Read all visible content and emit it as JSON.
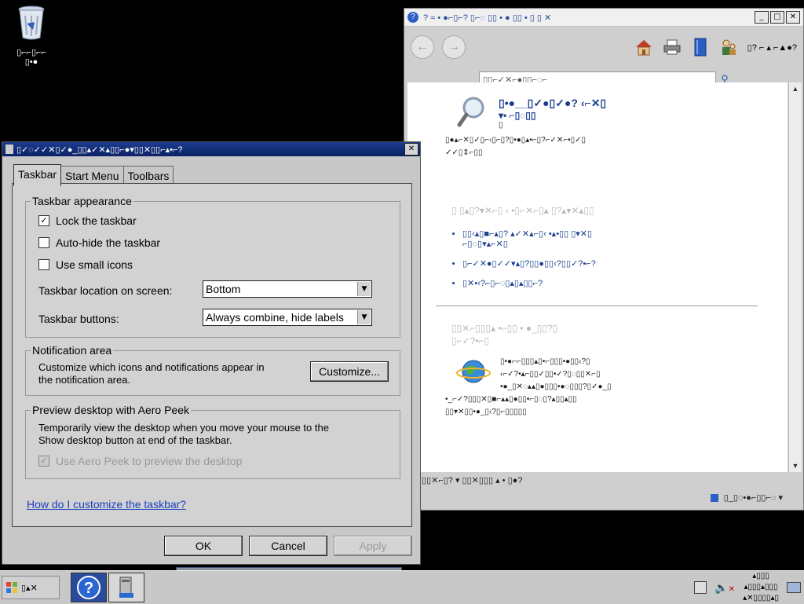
{
  "desktop": {
    "recycle_bin_label_line1": "▯⌐⌐▯⌐⌐",
    "recycle_bin_label_line2": "▯•●"
  },
  "help_window": {
    "title": "? ≈ • ●⌐▯⌐? ▯⌐◌ ▯▯ • ● ▯▯ • ▯ ▯ ✕",
    "toolbar_label": "▯? ⌐ ▴ ⌐▲●?",
    "search_text": "▯▯⌐✓✕⌐●▯▯⌐◌⌐",
    "heading": "▯•●__▯✓●▯✓●? ‹⌐✕▯",
    "heading2": "▾• ⌐▯◌▯▯",
    "heading_small": "▯",
    "intro": "▯●▴⌐✕▯✓▯⌐‹▯⌐▯?▯•●▯▴•⌐▯?⌐✓✕⌐•▯✓▯",
    "intro2": "✓✓▯⇕⌐▯▯",
    "subhead1": "▯ ▯▴▯?▾✕⌐▯ ‹ •▯⌐✕⌐▯▴ ▯?▴▾✕▴▯▯",
    "bullets": [
      "▯▯‹▴▯■⌐▴▯? ▴✓✕▴⌐▯‹ •▴•▯▯ ▯▾✕▯",
      "▯⌐✓✕●▯✓✓▾▴▯?▯▯●▯▯‹?▯▯✓?•⌐?",
      "▯✕•‹?⌐▯⌐◌▯▴▯▴▯▯⌐?"
    ],
    "bullet_cont": "⌐▯◌▯▾▴⌐✕▯",
    "subhead2": "▯▯✕⌐▯▯▯▴ •⌐▯▯ • ●_▯▯?▯",
    "subhead2b": "▯⌐✓?•⌐▯",
    "body_lines": [
      "▯•●⌐⌐▯▯▯▴▯•⌐▯▯▯•●▯▯‹?▯",
      "‹⌐✓?•▴⌐▯▯✓▯▯•✓?▯◌▯▯✕⌐▯",
      "•●_▯✕◌▴▴▯●▯▯▯•●◌▯▯▯?▯✓●_▯",
      "•_⌐✓?▯▯▯✕▯■⌐▴▴▯●▯▯•⌐▯◌▯?▴▯▯▴▯▯",
      "▯▯▾✕▯▯•●_▯‹?▯⌐▯▯▯▯▯"
    ],
    "status_left": "▯▯✕⌐▯? ▾ ▯▯✕▯▯▯ ▴ • ▯●?",
    "status_right": "▯_▯◌•●⌐▯▯⌐◌ ▾"
  },
  "dialog": {
    "title": "▯✓◌✓✓✕▯✓●_▯▯▴✓✕▴▯▯⌐●▾▯▯✕▯▯⌐▴•⌐?",
    "tabs": [
      "Taskbar",
      "Start Menu",
      "Toolbars"
    ],
    "appearance": {
      "legend": "Taskbar appearance",
      "lock_label": "Lock the taskbar",
      "lock_checked": true,
      "autohide_label": "Auto-hide the taskbar",
      "autohide_checked": false,
      "small_icons_label": "Use small icons",
      "small_icons_checked": false,
      "location_label": "Taskbar location on screen:",
      "location_value": "Bottom",
      "buttons_label": "Taskbar buttons:",
      "buttons_value": "Always combine, hide labels"
    },
    "notification": {
      "legend": "Notification area",
      "text_line1": "Customize which icons and notifications appear in",
      "text_line2": "the notification area.",
      "customize_label": "Customize..."
    },
    "aero": {
      "legend": "Preview desktop with Aero Peek",
      "text_line1": "Temporarily view the desktop when you move your mouse to the",
      "text_line2": "Show desktop button at end of the taskbar.",
      "checkbox_label": "Use Aero Peek to preview the desktop",
      "checkbox_checked": true,
      "checkbox_disabled": true
    },
    "help_link": "How do I customize the taskbar?",
    "ok_label": "OK",
    "cancel_label": "Cancel",
    "apply_label": "Apply"
  },
  "taskbar": {
    "start_label": "▯▴✕",
    "tray_line1": "▴▯▯▯",
    "tray_line2": "▴▯▯▯▴▯▯▯",
    "tray_line3": "▴✕▯▯▯▯▴▯"
  }
}
